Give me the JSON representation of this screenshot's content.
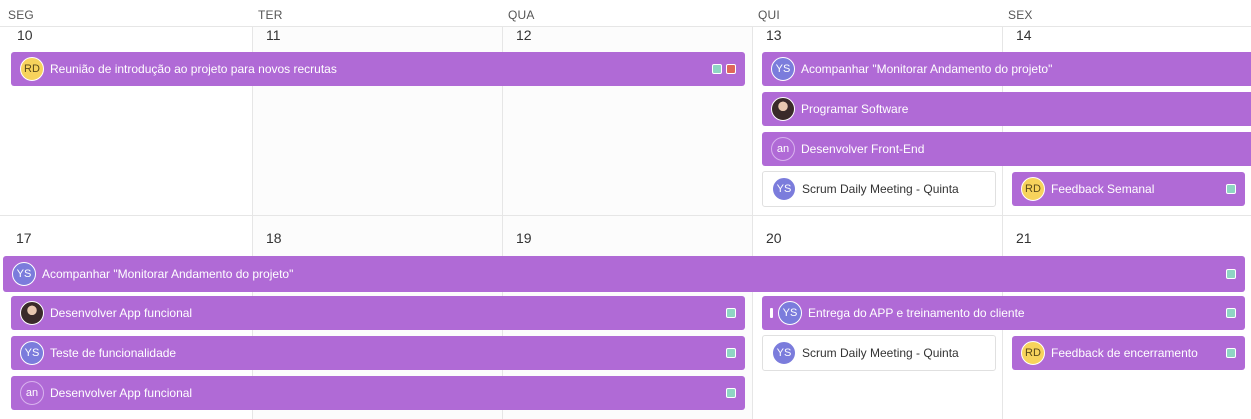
{
  "header": {
    "days": [
      "SEG",
      "TER",
      "QUA",
      "QUI",
      "SEX"
    ]
  },
  "weeks": [
    {
      "days": [
        "10",
        "11",
        "12",
        "13",
        "14"
      ],
      "events": [
        {
          "avatar": "RD",
          "title": "Reunião de introdução ao projeto para novos recrutas",
          "tags": [
            "teal",
            "red"
          ]
        },
        {
          "avatar": "YS",
          "title": "Acompanhar \"Monitorar Andamento do projeto\"",
          "tags": []
        },
        {
          "avatar": "",
          "title": "Programar Software",
          "tags": []
        },
        {
          "avatar": "an",
          "title": "Desenvolver Front-End",
          "tags": []
        },
        {
          "avatar": "YS",
          "title": "Scrum Daily Meeting - Quinta",
          "tags": []
        },
        {
          "avatar": "RD",
          "title": "Feedback Semanal",
          "tags": [
            "teal"
          ]
        }
      ]
    },
    {
      "days": [
        "17",
        "18",
        "19",
        "20",
        "21"
      ],
      "events": [
        {
          "avatar": "YS",
          "title": "Acompanhar \"Monitorar Andamento do projeto\"",
          "tags": [
            "teal"
          ]
        },
        {
          "avatar": "",
          "title": "Desenvolver App funcional",
          "tags": [
            "teal"
          ]
        },
        {
          "avatar": "YS",
          "title": "Entrega do APP e treinamento do cliente",
          "tags": [
            "teal"
          ]
        },
        {
          "avatar": "YS",
          "title": "Teste de funcionalidade",
          "tags": [
            "teal"
          ]
        },
        {
          "avatar": "YS",
          "title": "Scrum Daily Meeting - Quinta",
          "tags": []
        },
        {
          "avatar": "RD",
          "title": "Feedback de encerramento",
          "tags": [
            "teal"
          ]
        },
        {
          "avatar": "an",
          "title": "Desenvolver App funcional",
          "tags": [
            "teal"
          ]
        }
      ]
    }
  ],
  "colors": {
    "event_purple": "#b06ad6",
    "tag_teal": "#8fd5c4",
    "tag_red": "#e0675a",
    "avatar_rd": "#f7d35c",
    "avatar_ys": "#7b7cdc"
  }
}
